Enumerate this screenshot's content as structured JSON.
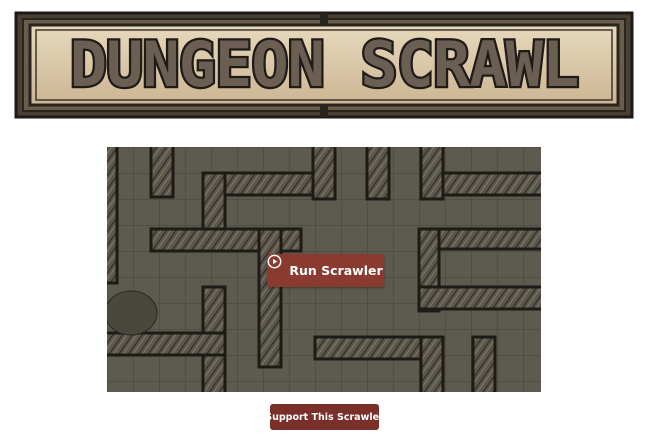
{
  "logo": {
    "text": "DUNGEON SCRAWL"
  },
  "map": {
    "run_button_label": "Run Scrawler",
    "run_button_icon": "play-circle-icon"
  },
  "support_button_label": "Support This Scrawler",
  "colors": {
    "button": "#8a3a2f",
    "support_button": "#7a3029",
    "map_floor": "#5d5a4f",
    "map_wall": "#2a2722",
    "logo_parchment": "#d8c7a6"
  }
}
